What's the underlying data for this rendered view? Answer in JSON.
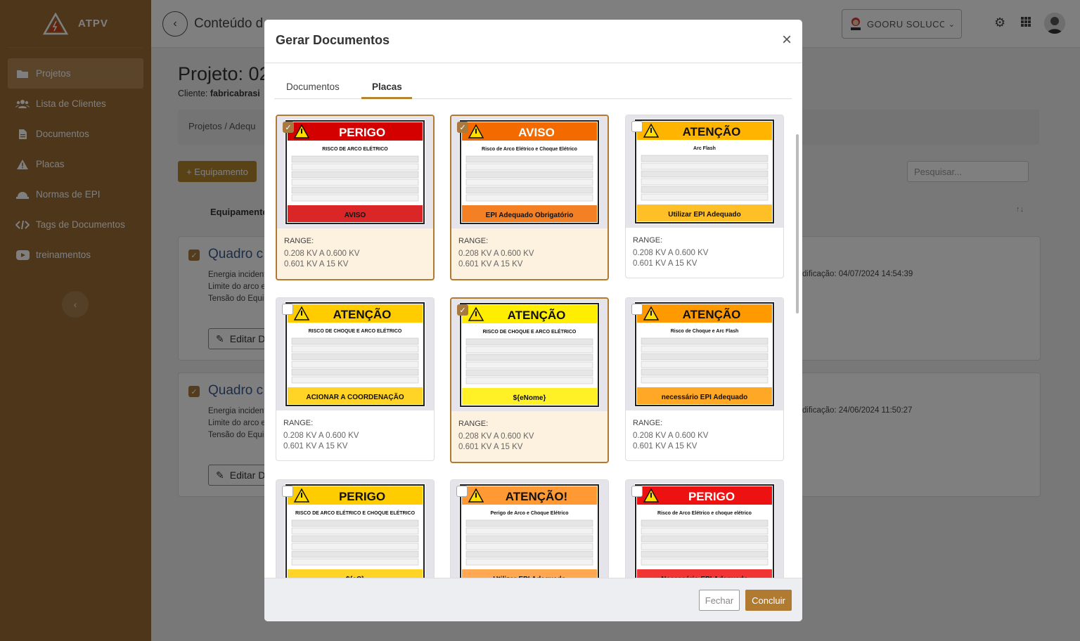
{
  "app": {
    "name": "ATPV"
  },
  "sidebar": {
    "items": [
      {
        "label": "Projetos",
        "icon": "folder-icon"
      },
      {
        "label": "Lista de Clientes",
        "icon": "users-icon"
      },
      {
        "label": "Documentos",
        "icon": "document-icon"
      },
      {
        "label": "Placas",
        "icon": "warning-icon"
      },
      {
        "label": "Normas de EPI",
        "icon": "helmet-icon"
      },
      {
        "label": "Tags de Documentos",
        "icon": "code-icon"
      },
      {
        "label": "treinamentos",
        "icon": "youtube-icon"
      }
    ]
  },
  "topbar": {
    "title": "Conteúdo d",
    "company": "GOORU SOLUCO..."
  },
  "page": {
    "title": "Projeto: 02",
    "client_label": "Cliente:",
    "client": "fabricabrasi",
    "breadcrumb": [
      "Projetos",
      "Adequ"
    ],
    "add_button": "+ Equipamento",
    "search_placeholder": "Pesquisar...",
    "column_header": "Equipamento",
    "cards": [
      {
        "title": "Quadro c",
        "lines": [
          "Energia incident",
          "Limite do arco e",
          "Tensão do Equi"
        ],
        "meta": "dificação: 04/07/2024 14:54:39",
        "edit": "Editar D"
      },
      {
        "title": "Quadro c",
        "lines": [
          "Energia incident",
          "Limite do arco e",
          "Tensão do Equi"
        ],
        "meta": "dificação: 24/06/2024 11:50:27",
        "edit": "Editar D"
      }
    ]
  },
  "modal": {
    "title": "Gerar Documentos",
    "tabs": [
      "Documentos",
      "Placas"
    ],
    "active_tab": "Placas",
    "plates": [
      {
        "header": "PERIGO",
        "header_color": "#d40000",
        "selected": true,
        "range_label": "RANGE:",
        "ranges": [
          "0.208 KV A 0.600 KV",
          "0.601 KV A 15 KV"
        ],
        "subtitle": "RISCO DE ARCO ELÉTRICO",
        "footer_text": "AVISO"
      },
      {
        "header": "AVISO",
        "header_color": "#f26a00",
        "selected": true,
        "range_label": "RANGE:",
        "ranges": [
          "0.208 KV A 0.600 KV",
          "0.601 KV A 15 KV"
        ],
        "subtitle": "Risco de Arco Elétrico e Choque Elétrico",
        "footer_text": "EPI Adequado Obrigatório"
      },
      {
        "header": "ATENÇÃO",
        "header_color": "#ffb400",
        "selected": false,
        "range_label": "RANGE:",
        "ranges": [
          "0.208 KV A 0.600 KV",
          "0.601 KV A 15 KV"
        ],
        "subtitle": "Arc Flash",
        "footer_text": "Utilizar EPI Adequado"
      },
      {
        "header": "ATENÇÃO",
        "header_color": "#ffcc00",
        "selected": false,
        "range_label": "RANGE:",
        "ranges": [
          "0.208 KV A 0.600 KV",
          "0.601 KV A 15 KV"
        ],
        "subtitle": "RISCO DE CHOQUE E ARCO ELÉTRICO",
        "footer_text": "ACIONAR A COORDENAÇÃO"
      },
      {
        "header": "ATENÇÃO",
        "header_color": "#ffee00",
        "selected": true,
        "range_label": "RANGE:",
        "ranges": [
          "0.208 KV A 0.600 KV",
          "0.601 KV A 15 KV"
        ],
        "subtitle": "RISCO DE CHOQUE E ARCO ELÉTRICO",
        "footer_text": "${eNome}"
      },
      {
        "header": "ATENÇÃO",
        "header_color": "#ff9900",
        "selected": false,
        "range_label": "RANGE:",
        "ranges": [
          "0.208 KV A 0.600 KV",
          "0.601 KV A 15 KV"
        ],
        "subtitle": "Risco de Choque e Arc Flash",
        "footer_text": "necessário EPI Adequado"
      },
      {
        "header": "PERIGO",
        "header_color": "#ffcc00",
        "selected": false,
        "range_label": "",
        "ranges": [],
        "subtitle": "RISCO DE ARCO ELÉTRICO E CHOQUE ELÉTRICO",
        "footer_text": "${eC}"
      },
      {
        "header": "ATENÇÃO!",
        "header_color": "#ff9933",
        "selected": false,
        "range_label": "",
        "ranges": [],
        "subtitle": "Perigo de Arco e Choque Elétrico",
        "footer_text": "Utilizar EPI Adequado"
      },
      {
        "header": "PERIGO",
        "header_color": "#ee1111",
        "selected": false,
        "range_label": "",
        "ranges": [],
        "subtitle": "Risco de Arco Elétrico e choque elétrico",
        "footer_text": "Necessário EPI Adequado"
      }
    ],
    "close_button": "Fechar",
    "confirm_button": "Concluir"
  },
  "colors": {
    "sidebar": "#9a6d33",
    "accent": "#b07a30",
    "selected_bg": "#fdf1df"
  }
}
